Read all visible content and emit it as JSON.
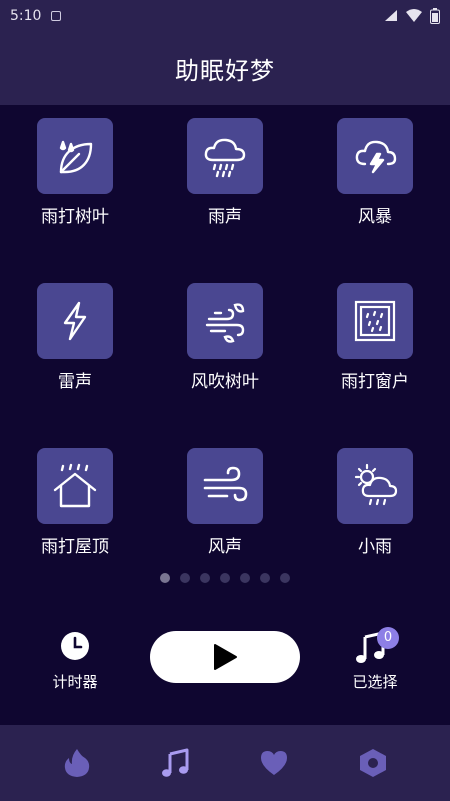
{
  "status_bar": {
    "time": "5:10"
  },
  "header": {
    "title": "助眠好梦"
  },
  "sounds": [
    {
      "label": "雨打树叶",
      "icon": "rain-leaf-icon"
    },
    {
      "label": "雨声",
      "icon": "rain-cloud-icon"
    },
    {
      "label": "风暴",
      "icon": "storm-cloud-icon"
    },
    {
      "label": "雷声",
      "icon": "lightning-icon"
    },
    {
      "label": "风吹树叶",
      "icon": "wind-leaf-icon"
    },
    {
      "label": "雨打窗户",
      "icon": "rain-window-icon"
    },
    {
      "label": "雨打屋顶",
      "icon": "rain-roof-icon"
    },
    {
      "label": "风声",
      "icon": "wind-icon"
    },
    {
      "label": "小雨",
      "icon": "sun-rain-icon"
    }
  ],
  "pagination": {
    "pages": 7,
    "active": 1
  },
  "controls": {
    "timer_label": "计时器",
    "selected_label": "已选择",
    "selected_count": "0"
  },
  "bottom_nav": [
    "fire-icon",
    "music-note-icon",
    "heart-icon",
    "settings-hex-icon"
  ],
  "colors": {
    "background": "#0f0630",
    "header": "#2b2250",
    "tile": "#4a4791",
    "accent": "#8d7fe6",
    "nav_icon": "#6a5fb8",
    "nav_active": "#a99bf0"
  }
}
